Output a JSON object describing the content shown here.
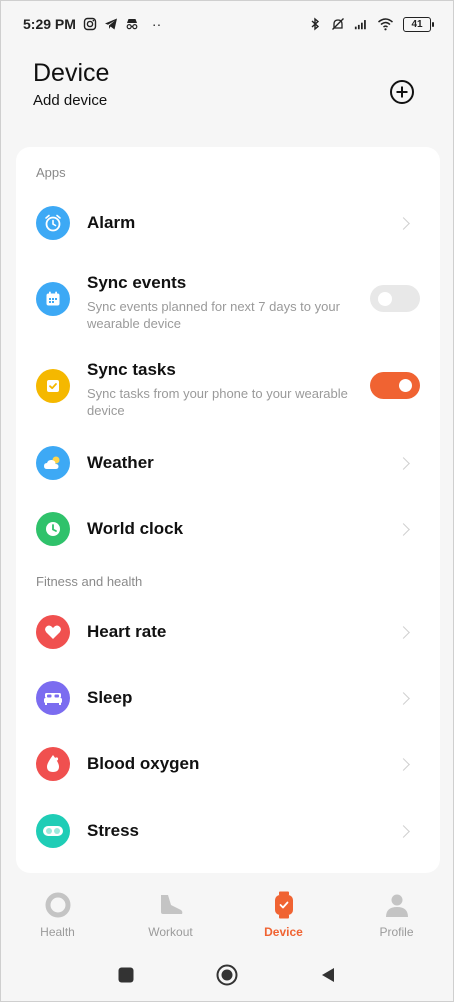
{
  "status_bar": {
    "time": "5:29 PM",
    "battery": "41",
    "dots": "··"
  },
  "header": {
    "title": "Device",
    "subtitle": "Add device"
  },
  "sections": {
    "apps_label": "Apps",
    "fitness_label": "Fitness and health"
  },
  "apps": [
    {
      "title": "Alarm",
      "icon": "alarm-icon",
      "color": "#3da9f5"
    },
    {
      "title": "Sync events",
      "desc": "Sync events planned for next 7 days to your wearable device",
      "icon": "calendar-icon",
      "color": "#3da9f5",
      "toggle": false
    },
    {
      "title": "Sync tasks",
      "desc": "Sync tasks from your phone to your wearable device",
      "icon": "task-icon",
      "color": "#f5b800",
      "toggle": true
    },
    {
      "title": "Weather",
      "icon": "weather-icon",
      "color": "#3da9f5"
    },
    {
      "title": "World clock",
      "icon": "clock-icon",
      "color": "#2fc26b"
    }
  ],
  "fitness": [
    {
      "title": "Heart rate",
      "icon": "heart-icon",
      "color": "#f0504f"
    },
    {
      "title": "Sleep",
      "icon": "bed-icon",
      "color": "#7b6cf0"
    },
    {
      "title": "Blood oxygen",
      "icon": "drop-icon",
      "color": "#f0504f"
    },
    {
      "title": "Stress",
      "icon": "stress-icon",
      "color": "#1fcdb6"
    }
  ],
  "bottom_nav": [
    {
      "label": "Health",
      "active": false
    },
    {
      "label": "Workout",
      "active": false
    },
    {
      "label": "Device",
      "active": true
    },
    {
      "label": "Profile",
      "active": false
    }
  ],
  "colors": {
    "accent": "#f06332",
    "background": "#f6f6f6",
    "card": "#ffffff"
  }
}
